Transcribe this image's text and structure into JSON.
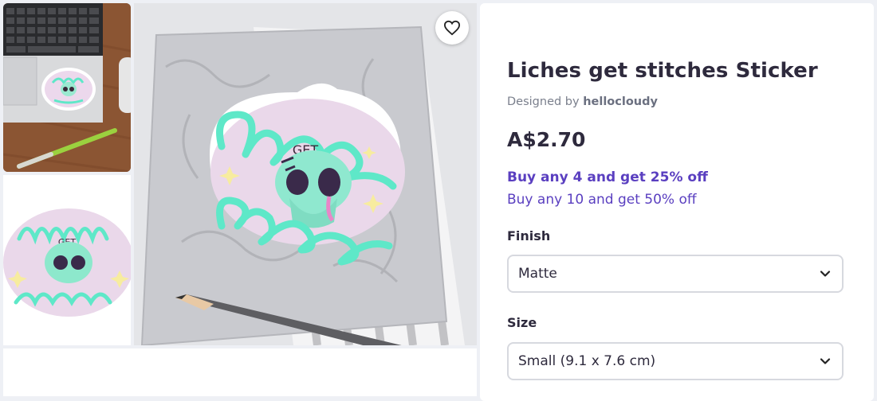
{
  "product": {
    "title": "Liches get stitches Sticker",
    "designed_by_prefix": "Designed by",
    "designer": "hellocloudy",
    "price": "A$2.70"
  },
  "promotions": [
    "Buy any 4 and get 25% off",
    "Buy any 10 and get 50% off"
  ],
  "options": {
    "finish": {
      "label": "Finish",
      "value": "Matte"
    },
    "size": {
      "label": "Size",
      "value": "Small (9.1 x 7.6 cm)"
    }
  },
  "sticker_art": {
    "line1": "liches",
    "line2": "GET",
    "line3": "STITCHES"
  },
  "colors": {
    "accent": "#5a3fc0",
    "title": "#2e2a3d",
    "sticker_mint": "#5ee8c8",
    "sticker_pink": "#ead8ea"
  },
  "icons": {
    "favorite": "heart-outline-icon",
    "dropdown": "chevron-down-icon"
  }
}
